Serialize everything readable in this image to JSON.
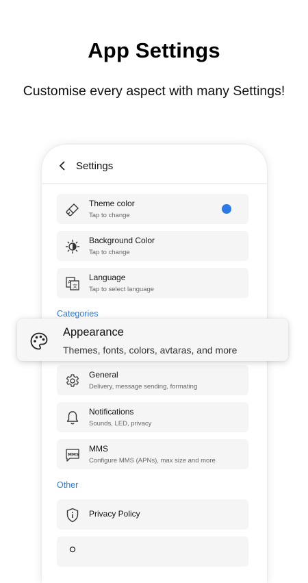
{
  "promo": {
    "headline": "App Settings",
    "subtitle": "Customise every aspect with many Settings!"
  },
  "appbar": {
    "back_icon": "arrow-back-icon",
    "title": "Settings"
  },
  "general_items": [
    {
      "title": "Theme color",
      "subtitle": "Tap to change",
      "icon": "brush-icon",
      "swatch_color": "#2a79e6"
    },
    {
      "title": "Background Color",
      "subtitle": "Tap to change",
      "icon": "brightness-icon"
    },
    {
      "title": "Language",
      "subtitle": "Tap to select language",
      "icon": "translate-icon"
    }
  ],
  "categories": {
    "label": "Categories",
    "items": [
      {
        "title": "Appearance",
        "subtitle": "Themes, fonts, colors, avtaras, and more",
        "icon": "palette-icon"
      },
      {
        "title": "General",
        "subtitle": "Delivery, message sending, formating",
        "icon": "gear-icon"
      },
      {
        "title": "Notifications",
        "subtitle": "Sounds, LED, privacy",
        "icon": "bell-icon"
      },
      {
        "title": "MMS",
        "subtitle": "Configure MMS (APNs), max size and more",
        "icon": "mms-icon"
      }
    ]
  },
  "other": {
    "label": "Other",
    "items": [
      {
        "title": "Privacy Policy",
        "icon": "shield-info-icon"
      }
    ]
  },
  "colors": {
    "accent": "#2a79e6",
    "card_bg": "#f5f5f5"
  }
}
